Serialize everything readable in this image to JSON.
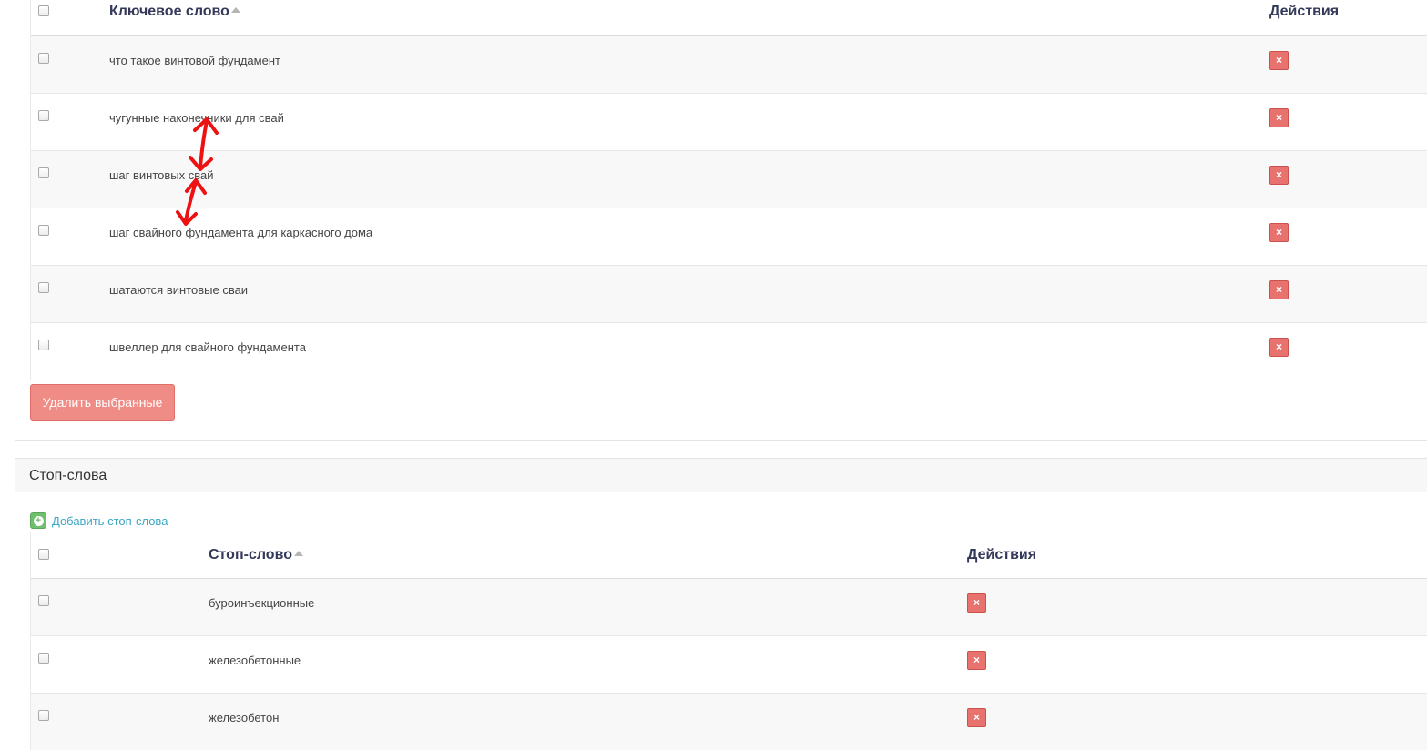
{
  "keywords_table": {
    "header": {
      "keyword_label": "Ключевое слово",
      "actions_label": "Действия"
    },
    "rows": [
      {
        "keyword": "что такое винтовой фундамент",
        "delete": "×"
      },
      {
        "keyword": "чугунные наконечники для свай",
        "delete": "×"
      },
      {
        "keyword": "шаг винтовых свай",
        "delete": "×"
      },
      {
        "keyword": "шаг свайного фундамента для каркасного дома",
        "delete": "×"
      },
      {
        "keyword": "шатаются винтовые сваи",
        "delete": "×"
      },
      {
        "keyword": "швеллер для свайного фундамента",
        "delete": "×"
      }
    ],
    "delete_selected_label": "Удалить выбранные"
  },
  "stopwords_panel": {
    "title": "Стоп-слова",
    "add_link_label": "Добавить стоп-слова",
    "header": {
      "stopword_label": "Стоп-слово",
      "actions_label": "Действия"
    },
    "rows": [
      {
        "stopword": "буроинъекционные",
        "delete": "×"
      },
      {
        "stopword": "железобетонные",
        "delete": "×"
      },
      {
        "stopword": "железобетон",
        "delete": "×"
      }
    ]
  },
  "colors": {
    "danger": "#e8726d",
    "danger_button": "#f08c86",
    "link": "#3aa7c4",
    "add_icon": "#6fbf6f",
    "annotation": "#ff0000"
  },
  "icons": {
    "delete": "close-icon",
    "add": "plus-circle-icon",
    "sort": "sort-asc-icon"
  }
}
